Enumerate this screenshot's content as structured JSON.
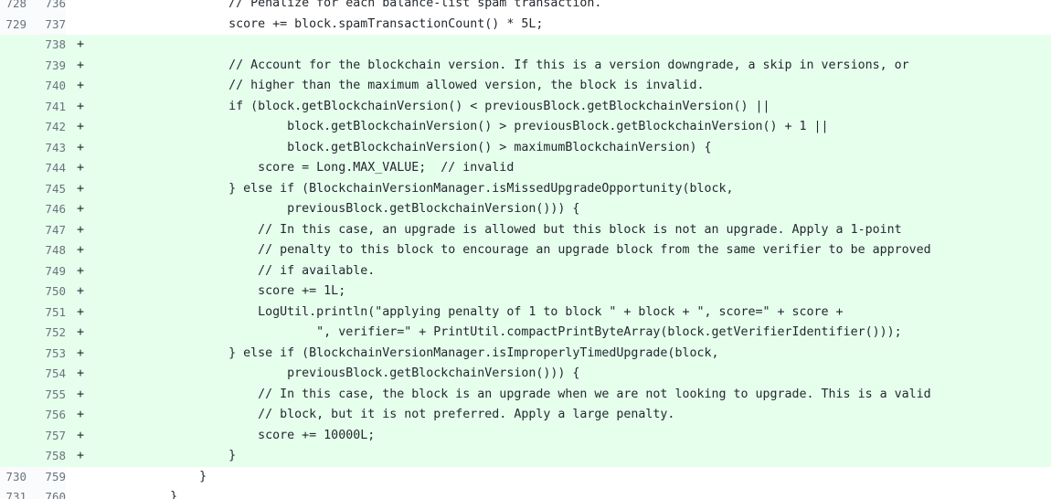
{
  "diff": {
    "lines": [
      {
        "old": "728",
        "new": "736",
        "marker": "",
        "type": "ctx",
        "text": "                    // Penalize for each balance-list spam transaction."
      },
      {
        "old": "729",
        "new": "737",
        "marker": "",
        "type": "ctx",
        "text": "                    score += block.spamTransactionCount() * 5L;"
      },
      {
        "old": "",
        "new": "738",
        "marker": "+",
        "type": "add",
        "text": ""
      },
      {
        "old": "",
        "new": "739",
        "marker": "+",
        "type": "add",
        "text": "                    // Account for the blockchain version. If this is a version downgrade, a skip in versions, or"
      },
      {
        "old": "",
        "new": "740",
        "marker": "+",
        "type": "add",
        "text": "                    // higher than the maximum allowed version, the block is invalid."
      },
      {
        "old": "",
        "new": "741",
        "marker": "+",
        "type": "add",
        "text": "                    if (block.getBlockchainVersion() < previousBlock.getBlockchainVersion() ||"
      },
      {
        "old": "",
        "new": "742",
        "marker": "+",
        "type": "add",
        "text": "                            block.getBlockchainVersion() > previousBlock.getBlockchainVersion() + 1 ||"
      },
      {
        "old": "",
        "new": "743",
        "marker": "+",
        "type": "add",
        "text": "                            block.getBlockchainVersion() > maximumBlockchainVersion) {"
      },
      {
        "old": "",
        "new": "744",
        "marker": "+",
        "type": "add",
        "text": "                        score = Long.MAX_VALUE;  // invalid"
      },
      {
        "old": "",
        "new": "745",
        "marker": "+",
        "type": "add",
        "text": "                    } else if (BlockchainVersionManager.isMissedUpgradeOpportunity(block,"
      },
      {
        "old": "",
        "new": "746",
        "marker": "+",
        "type": "add",
        "text": "                            previousBlock.getBlockchainVersion())) {"
      },
      {
        "old": "",
        "new": "747",
        "marker": "+",
        "type": "add",
        "text": "                        // In this case, an upgrade is allowed but this block is not an upgrade. Apply a 1-point"
      },
      {
        "old": "",
        "new": "748",
        "marker": "+",
        "type": "add",
        "text": "                        // penalty to this block to encourage an upgrade block from the same verifier to be approved"
      },
      {
        "old": "",
        "new": "749",
        "marker": "+",
        "type": "add",
        "text": "                        // if available."
      },
      {
        "old": "",
        "new": "750",
        "marker": "+",
        "type": "add",
        "text": "                        score += 1L;"
      },
      {
        "old": "",
        "new": "751",
        "marker": "+",
        "type": "add",
        "text": "                        LogUtil.println(\"applying penalty of 1 to block \" + block + \", score=\" + score +"
      },
      {
        "old": "",
        "new": "752",
        "marker": "+",
        "type": "add",
        "text": "                                \", verifier=\" + PrintUtil.compactPrintByteArray(block.getVerifierIdentifier()));"
      },
      {
        "old": "",
        "new": "753",
        "marker": "+",
        "type": "add",
        "text": "                    } else if (BlockchainVersionManager.isImproperlyTimedUpgrade(block,"
      },
      {
        "old": "",
        "new": "754",
        "marker": "+",
        "type": "add",
        "text": "                            previousBlock.getBlockchainVersion())) {"
      },
      {
        "old": "",
        "new": "755",
        "marker": "+",
        "type": "add",
        "text": "                        // In this case, the block is an upgrade when we are not looking to upgrade. This is a valid"
      },
      {
        "old": "",
        "new": "756",
        "marker": "+",
        "type": "add",
        "text": "                        // block, but it is not preferred. Apply a large penalty."
      },
      {
        "old": "",
        "new": "757",
        "marker": "+",
        "type": "add",
        "text": "                        score += 10000L;"
      },
      {
        "old": "",
        "new": "758",
        "marker": "+",
        "type": "add",
        "text": "                    }"
      },
      {
        "old": "730",
        "new": "759",
        "marker": "",
        "type": "ctx",
        "text": "                }"
      },
      {
        "old": "731",
        "new": "760",
        "marker": "",
        "type": "ctx",
        "text": "            }"
      }
    ]
  }
}
